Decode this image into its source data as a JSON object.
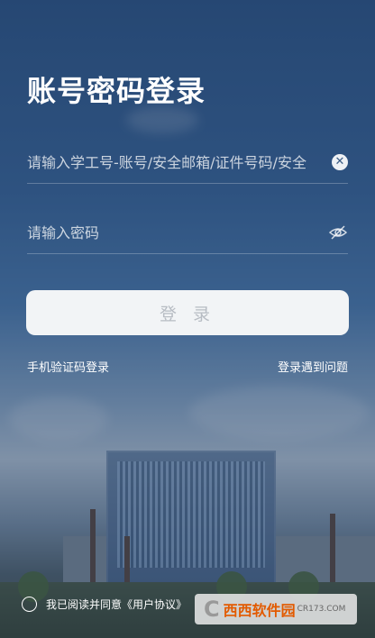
{
  "page": {
    "title": "账号密码登录"
  },
  "form": {
    "account_placeholder": "请输入学工号-账号/安全邮箱/证件号码/安全",
    "password_placeholder": "请输入密码",
    "login_label": "登 录"
  },
  "links": {
    "sms_login": "手机验证码登录",
    "help": "登录遇到问题"
  },
  "agreement": {
    "text": "我已阅读并同意《用户协议》"
  },
  "watermark": {
    "brand": "西西软件园",
    "domain": "CR173.COM"
  },
  "icons": {
    "clear": "close-icon",
    "toggle_password": "eye-off-icon"
  }
}
